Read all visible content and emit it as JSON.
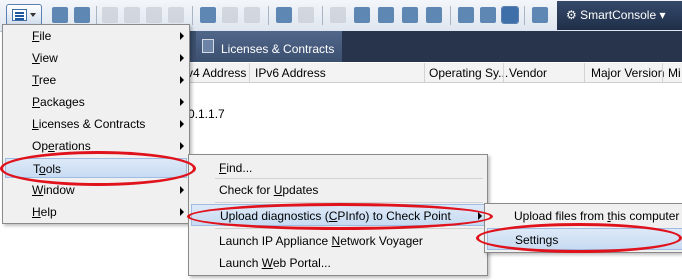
{
  "app": {
    "brand": "SmartConsole",
    "accent_color": "#e0121c",
    "toolbar_icons": [
      "menu-icon",
      "new-object-icon",
      "duplicate-icon",
      "session-icon",
      "task-icon",
      "install-icon",
      "publish-icon",
      "discard-icon",
      "network-icon",
      "vpn-icon",
      "install-policy-icon",
      "power-icon",
      "trust-icon",
      "user-icon",
      "user-add-icon",
      "user-settings-icon",
      "window-icon",
      "contact-icon",
      "layout-icon",
      "apps-icon"
    ]
  },
  "tab": {
    "label": "Licenses & Contracts"
  },
  "grid": {
    "columns": [
      "v4 Address",
      "IPv6 Address",
      "Operating Sy...",
      "Vendor",
      "Major Version",
      "Mi"
    ],
    "row_value": "0.1.1.7"
  },
  "main_menu": [
    {
      "pre": "",
      "u": "F",
      "post": "ile",
      "has_submenu": true
    },
    {
      "pre": "",
      "u": "V",
      "post": "iew",
      "has_submenu": true
    },
    {
      "pre": "",
      "u": "T",
      "post": "ree",
      "has_submenu": true
    },
    {
      "pre": "",
      "u": "P",
      "post": "ackages",
      "has_submenu": true
    },
    {
      "pre": "",
      "u": "L",
      "post": "icenses & Contracts",
      "has_submenu": true
    },
    {
      "pre": "Op",
      "u": "e",
      "post": "rations",
      "has_submenu": true
    },
    {
      "pre": "T",
      "u": "o",
      "post": "ols",
      "has_submenu": false
    },
    {
      "pre": "",
      "u": "W",
      "post": "indow",
      "has_submenu": true
    },
    {
      "pre": "",
      "u": "H",
      "post": "elp",
      "has_submenu": true
    }
  ],
  "tools_menu": [
    {
      "pre": "",
      "u": "F",
      "post": "ind..."
    },
    {
      "pre": "Check for ",
      "u": "U",
      "post": "pdates"
    },
    {
      "pre": "Upload diagnostics (",
      "u": "C",
      "post": "PInfo) to Check Point"
    },
    {
      "pre": "Launch IP Appliance ",
      "u": "N",
      "post": "etwork Voyager"
    },
    {
      "pre": "Launch ",
      "u": "W",
      "post": "eb Portal..."
    }
  ],
  "upload_menu": [
    {
      "pre": "Upload files from ",
      "u": "t",
      "post": "his computer"
    },
    {
      "pre": "",
      "u": "",
      "post": "Settings"
    }
  ]
}
